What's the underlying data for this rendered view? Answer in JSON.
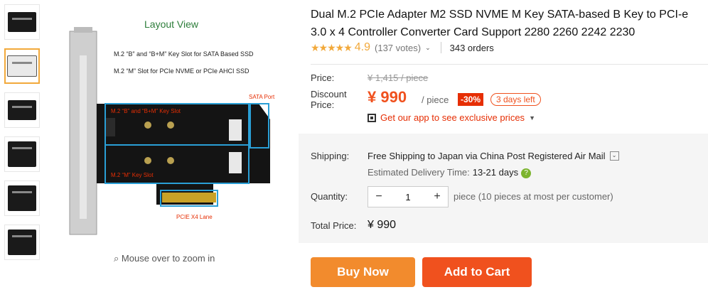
{
  "gallery": {
    "thumbnails": [
      "thumb-1",
      "thumb-2",
      "thumb-3",
      "thumb-4",
      "thumb-5",
      "thumb-6"
    ],
    "layout_title": "Layout View",
    "spec_line_1": "M.2 “B” and “B+M” Key Slot for SATA Based SSD",
    "spec_line_2": "M.2 “M” Slot for PCIe NVME or PCIe AHCI SSD",
    "sata_label": "SATA Port",
    "bm_slot_label": "M.2 “B” and “B+M” Key Slot",
    "m_slot_label": "M.2 “M” Key Slot",
    "pcie_label": "PCIE X4 Lane",
    "zoom_hint": "Mouse over to zoom in"
  },
  "product": {
    "title": "Dual M.2 PCIe Adapter M2 SSD NVME M Key SATA-based B Key to PCI-e 3.0 x 4 Controller Converter Card Support 2280 2260 2242 2230",
    "stars": "★★★★★",
    "rating": "4.9",
    "votes": "(137 votes)",
    "orders": "343 orders"
  },
  "pricing": {
    "price_label": "Price:",
    "old_price": "¥ 1,415 / piece",
    "discount_label": "Discount Price:",
    "price": "¥ 990",
    "per_unit": "/ piece",
    "discount_pct": "-30%",
    "days_left": "3 days left",
    "app_promo": "Get our app to see exclusive prices"
  },
  "shipping": {
    "label": "Shipping:",
    "value": "Free Shipping to Japan via China Post Registered Air Mail",
    "est_label": "Estimated Delivery Time:",
    "est_value": "13-21 days"
  },
  "quantity": {
    "label": "Quantity:",
    "minus": "−",
    "value": "1",
    "plus": "+",
    "note": "piece (10 pieces at most per customer)"
  },
  "total": {
    "label": "Total Price:",
    "value": "¥ 990"
  },
  "actions": {
    "buy_now": "Buy Now",
    "add_to_cart": "Add to Cart"
  },
  "colors": {
    "accent": "#f0511e",
    "buy": "#f28b2d",
    "star": "#f2a93b",
    "slot_outline": "#2a9fd6"
  }
}
